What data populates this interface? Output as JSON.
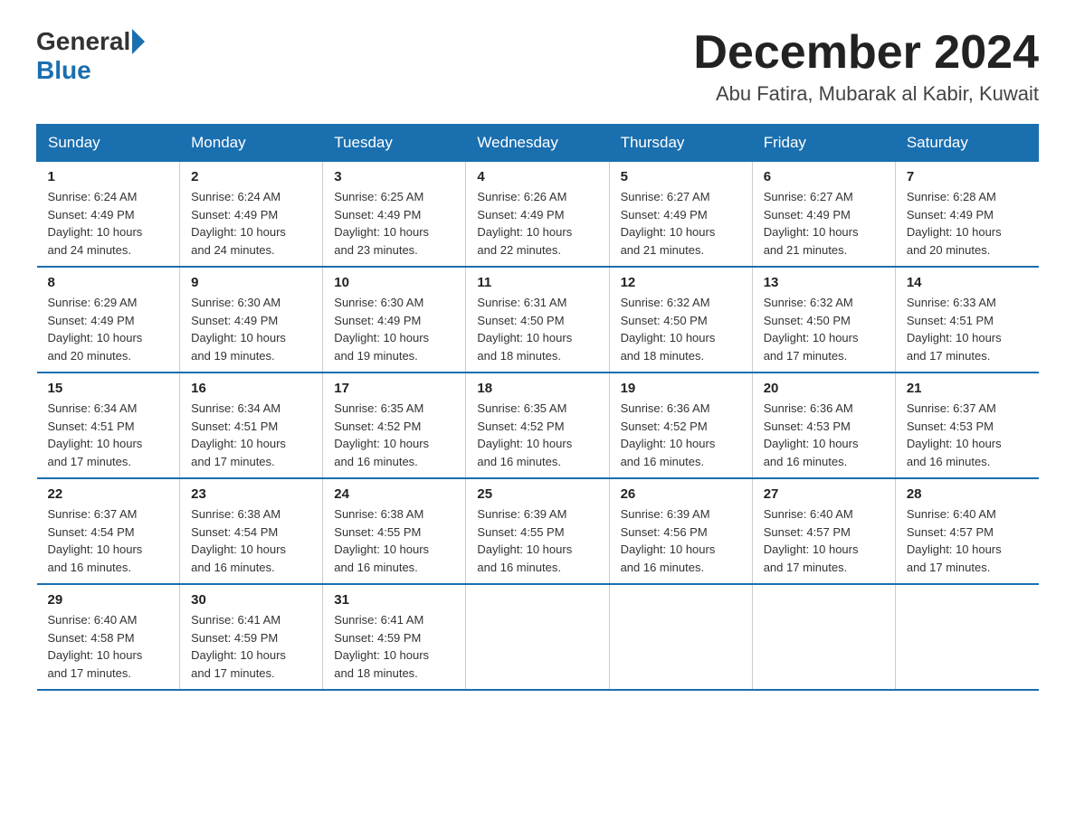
{
  "header": {
    "logo_general": "General",
    "logo_blue": "Blue",
    "month_title": "December 2024",
    "location": "Abu Fatira, Mubarak al Kabir, Kuwait"
  },
  "days_of_week": [
    "Sunday",
    "Monday",
    "Tuesday",
    "Wednesday",
    "Thursday",
    "Friday",
    "Saturday"
  ],
  "weeks": [
    [
      {
        "day": "1",
        "sunrise": "6:24 AM",
        "sunset": "4:49 PM",
        "daylight_hours": "10",
        "daylight_minutes": "24"
      },
      {
        "day": "2",
        "sunrise": "6:24 AM",
        "sunset": "4:49 PM",
        "daylight_hours": "10",
        "daylight_minutes": "24"
      },
      {
        "day": "3",
        "sunrise": "6:25 AM",
        "sunset": "4:49 PM",
        "daylight_hours": "10",
        "daylight_minutes": "23"
      },
      {
        "day": "4",
        "sunrise": "6:26 AM",
        "sunset": "4:49 PM",
        "daylight_hours": "10",
        "daylight_minutes": "22"
      },
      {
        "day": "5",
        "sunrise": "6:27 AM",
        "sunset": "4:49 PM",
        "daylight_hours": "10",
        "daylight_minutes": "21"
      },
      {
        "day": "6",
        "sunrise": "6:27 AM",
        "sunset": "4:49 PM",
        "daylight_hours": "10",
        "daylight_minutes": "21"
      },
      {
        "day": "7",
        "sunrise": "6:28 AM",
        "sunset": "4:49 PM",
        "daylight_hours": "10",
        "daylight_minutes": "20"
      }
    ],
    [
      {
        "day": "8",
        "sunrise": "6:29 AM",
        "sunset": "4:49 PM",
        "daylight_hours": "10",
        "daylight_minutes": "20"
      },
      {
        "day": "9",
        "sunrise": "6:30 AM",
        "sunset": "4:49 PM",
        "daylight_hours": "10",
        "daylight_minutes": "19"
      },
      {
        "day": "10",
        "sunrise": "6:30 AM",
        "sunset": "4:49 PM",
        "daylight_hours": "10",
        "daylight_minutes": "19"
      },
      {
        "day": "11",
        "sunrise": "6:31 AM",
        "sunset": "4:50 PM",
        "daylight_hours": "10",
        "daylight_minutes": "18"
      },
      {
        "day": "12",
        "sunrise": "6:32 AM",
        "sunset": "4:50 PM",
        "daylight_hours": "10",
        "daylight_minutes": "18"
      },
      {
        "day": "13",
        "sunrise": "6:32 AM",
        "sunset": "4:50 PM",
        "daylight_hours": "10",
        "daylight_minutes": "17"
      },
      {
        "day": "14",
        "sunrise": "6:33 AM",
        "sunset": "4:51 PM",
        "daylight_hours": "10",
        "daylight_minutes": "17"
      }
    ],
    [
      {
        "day": "15",
        "sunrise": "6:34 AM",
        "sunset": "4:51 PM",
        "daylight_hours": "10",
        "daylight_minutes": "17"
      },
      {
        "day": "16",
        "sunrise": "6:34 AM",
        "sunset": "4:51 PM",
        "daylight_hours": "10",
        "daylight_minutes": "17"
      },
      {
        "day": "17",
        "sunrise": "6:35 AM",
        "sunset": "4:52 PM",
        "daylight_hours": "10",
        "daylight_minutes": "16"
      },
      {
        "day": "18",
        "sunrise": "6:35 AM",
        "sunset": "4:52 PM",
        "daylight_hours": "10",
        "daylight_minutes": "16"
      },
      {
        "day": "19",
        "sunrise": "6:36 AM",
        "sunset": "4:52 PM",
        "daylight_hours": "10",
        "daylight_minutes": "16"
      },
      {
        "day": "20",
        "sunrise": "6:36 AM",
        "sunset": "4:53 PM",
        "daylight_hours": "10",
        "daylight_minutes": "16"
      },
      {
        "day": "21",
        "sunrise": "6:37 AM",
        "sunset": "4:53 PM",
        "daylight_hours": "10",
        "daylight_minutes": "16"
      }
    ],
    [
      {
        "day": "22",
        "sunrise": "6:37 AM",
        "sunset": "4:54 PM",
        "daylight_hours": "10",
        "daylight_minutes": "16"
      },
      {
        "day": "23",
        "sunrise": "6:38 AM",
        "sunset": "4:54 PM",
        "daylight_hours": "10",
        "daylight_minutes": "16"
      },
      {
        "day": "24",
        "sunrise": "6:38 AM",
        "sunset": "4:55 PM",
        "daylight_hours": "10",
        "daylight_minutes": "16"
      },
      {
        "day": "25",
        "sunrise": "6:39 AM",
        "sunset": "4:55 PM",
        "daylight_hours": "10",
        "daylight_minutes": "16"
      },
      {
        "day": "26",
        "sunrise": "6:39 AM",
        "sunset": "4:56 PM",
        "daylight_hours": "10",
        "daylight_minutes": "16"
      },
      {
        "day": "27",
        "sunrise": "6:40 AM",
        "sunset": "4:57 PM",
        "daylight_hours": "10",
        "daylight_minutes": "17"
      },
      {
        "day": "28",
        "sunrise": "6:40 AM",
        "sunset": "4:57 PM",
        "daylight_hours": "10",
        "daylight_minutes": "17"
      }
    ],
    [
      {
        "day": "29",
        "sunrise": "6:40 AM",
        "sunset": "4:58 PM",
        "daylight_hours": "10",
        "daylight_minutes": "17"
      },
      {
        "day": "30",
        "sunrise": "6:41 AM",
        "sunset": "4:59 PM",
        "daylight_hours": "10",
        "daylight_minutes": "17"
      },
      {
        "day": "31",
        "sunrise": "6:41 AM",
        "sunset": "4:59 PM",
        "daylight_hours": "10",
        "daylight_minutes": "18"
      },
      null,
      null,
      null,
      null
    ]
  ]
}
